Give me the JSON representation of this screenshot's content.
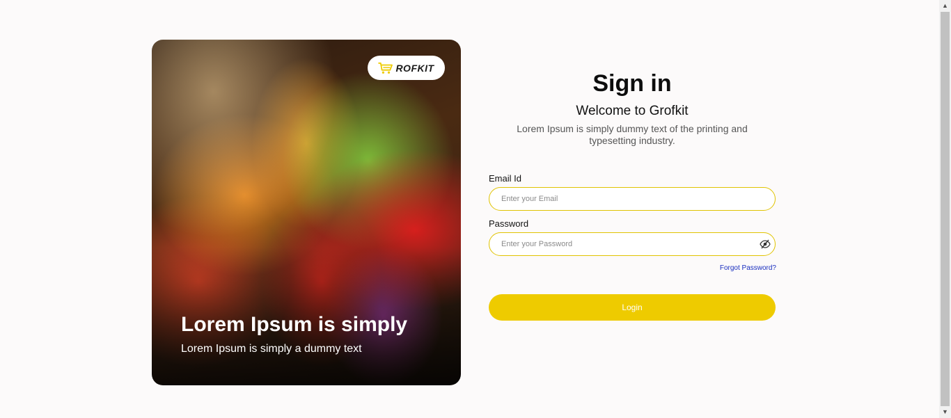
{
  "hero": {
    "brand": "ROFKIT",
    "title": "Lorem Ipsum is simply",
    "subtitle": "Lorem Ipsum is simply a dummy text"
  },
  "form": {
    "title": "Sign in",
    "welcome": "Welcome to Grofkit",
    "description": "Lorem Ipsum is simply dummy text of the printing and typesetting industry.",
    "email_label": "Email Id",
    "email_placeholder": "Enter your Email",
    "password_label": "Password",
    "password_placeholder": "Enter your Password",
    "forgot_label": "Forgot Password?",
    "login_label": "Login"
  },
  "icons": {
    "logo": "cart-icon",
    "password_toggle": "eye-slash-icon",
    "scroll_up": "chevron-up-icon",
    "scroll_down": "chevron-down-icon"
  },
  "colors": {
    "accent": "#eecb00",
    "input_border": "#e0c300",
    "link": "#1a2fbf",
    "background": "#fcfafa"
  }
}
